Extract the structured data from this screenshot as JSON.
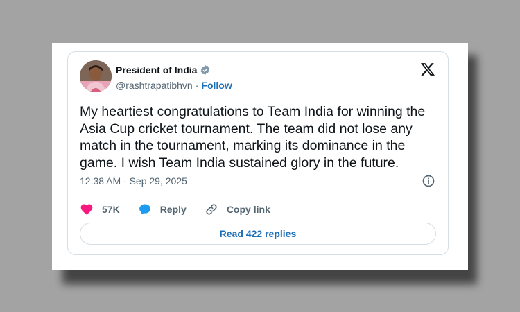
{
  "tweet": {
    "author_name": "President of India",
    "handle": "@rashtrapatibhvn",
    "separator": "·",
    "follow_label": "Follow",
    "text": "My heartiest congratulations to Team India for winning the Asia Cup cricket tournament. The team did not lose any match in the tournament, marking its dominance in the game. I wish Team India sustained glory in the future.",
    "timestamp": "12:38 AM · Sep 29, 2025"
  },
  "actions": {
    "like_count": "57K",
    "reply_label": "Reply",
    "copy_link_label": "Copy link"
  },
  "read_replies_label": "Read 422 replies",
  "colors": {
    "background": "#a3a3a3",
    "link_blue": "#1d6fb8",
    "heart_pink": "#f91880",
    "reply_blue": "#1d9bf0",
    "verified_gray": "#829aab"
  },
  "icons": [
    "verified-badge-icon",
    "x-logo-icon",
    "info-icon",
    "heart-icon",
    "reply-icon",
    "link-icon"
  ]
}
